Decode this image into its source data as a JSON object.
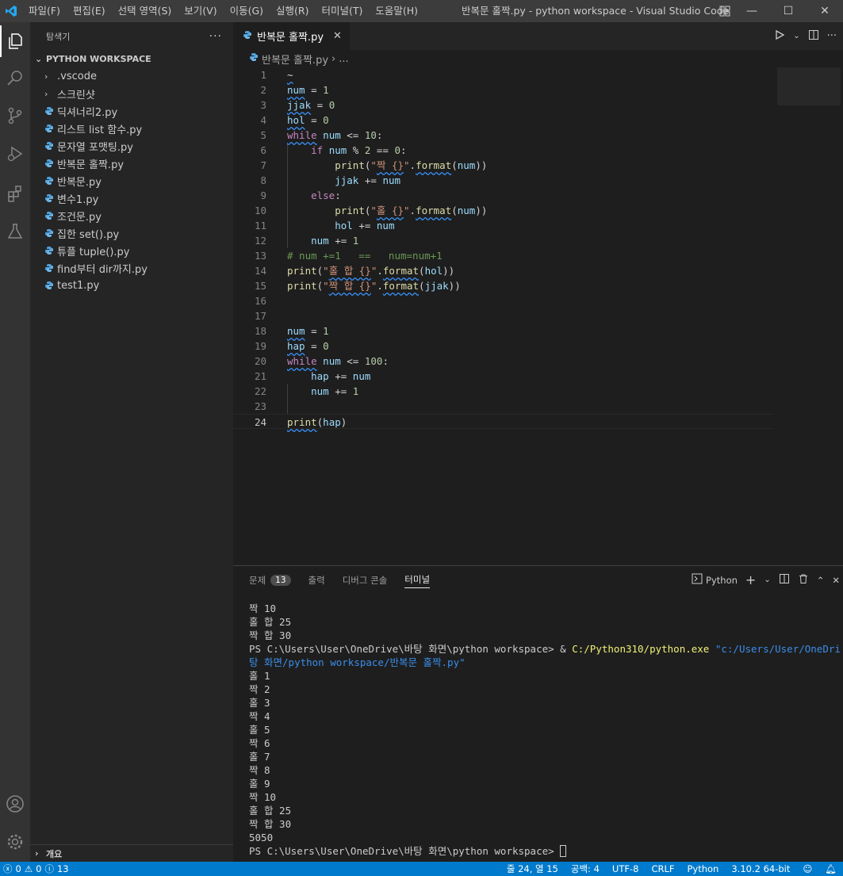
{
  "window": {
    "menu": [
      "파일(F)",
      "편집(E)",
      "선택 영역(S)",
      "보기(V)",
      "이동(G)",
      "실행(R)",
      "터미널(T)",
      "도움말(H)"
    ],
    "title": "반복문 홀짝.py - python workspace - Visual Studio Code"
  },
  "sidebar": {
    "header": "탐색기",
    "workspace": "PYTHON WORKSPACE",
    "folders": [
      ".vscode",
      "스크린샷"
    ],
    "files": [
      "딕셔너리2.py",
      "리스트 list 함수.py",
      "문자열 포맷팅.py",
      "반복문 홀짝.py",
      "반복문.py",
      "변수1.py",
      "조건문.py",
      "집한 set().py",
      "튜플 tuple().py",
      "find부터 dir까지.py",
      "test1.py"
    ],
    "outline": "개요"
  },
  "editor": {
    "tab_label": "반복문 홀짝.py",
    "breadcrumb_file": "반복문 홀짝.py",
    "breadcrumb_more": "...",
    "line_numbers": [
      "1",
      "2",
      "3",
      "4",
      "5",
      "6",
      "7",
      "8",
      "9",
      "10",
      "11",
      "12",
      "13",
      "14",
      "15",
      "16",
      "17",
      "18",
      "19",
      "20",
      "21",
      "22",
      "23",
      "24"
    ],
    "current_line": 24
  },
  "panel": {
    "tabs": [
      "문제",
      "출력",
      "디버그 콘솔",
      "터미널"
    ],
    "problems_count": "13",
    "shell": "Python",
    "terminal_lines": [
      "짝 10",
      "홀 합 25",
      "짝 합 30",
      "PS C:\\Users\\User\\OneDrive\\바탕 화면\\python workspace> & ",
      "탕 화면/python workspace/반복문 홀짝.py\"",
      "홀 1",
      "짝 2",
      "홀 3",
      "짝 4",
      "홀 5",
      "짝 6",
      "홀 7",
      "짝 8",
      "홀 9",
      "짝 10",
      "홀 합 25",
      "짝 합 30",
      "5050",
      "PS C:\\Users\\User\\OneDrive\\바탕 화면\\python workspace> "
    ],
    "cmd_exe": "C:/Python310/python.exe",
    "cmd_arg": "\"c:/Users/User/OneDrive/바"
  },
  "statusbar": {
    "errors": "0",
    "warnings": "0",
    "infos": "13",
    "position": "줄 24, 열 15",
    "spaces": "공백: 4",
    "encoding": "UTF-8",
    "eol": "CRLF",
    "language": "Python",
    "interpreter": "3.10.2 64-bit"
  },
  "colors": {
    "accent": "#007acc",
    "keyword": "#c586c0",
    "variable": "#9cdcfe",
    "string": "#ce9178",
    "function": "#dcdcaa",
    "number": "#b5cea8",
    "comment": "#6a9955"
  }
}
